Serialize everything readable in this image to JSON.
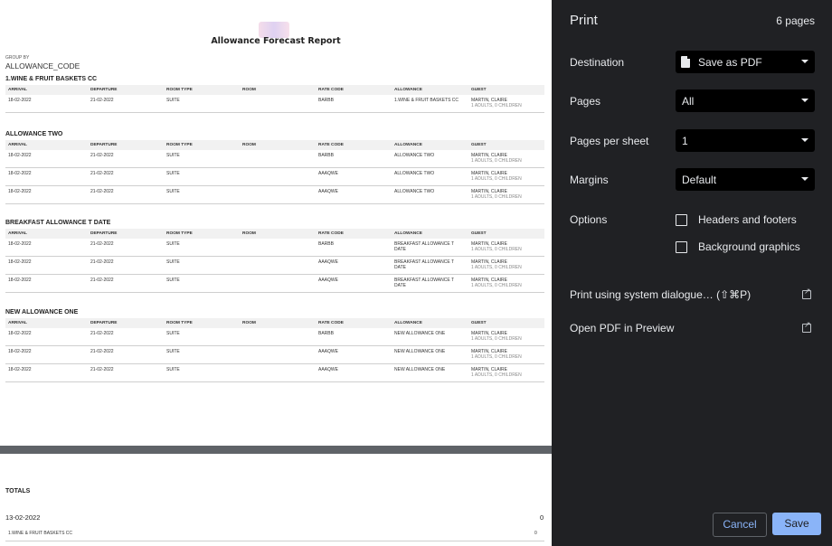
{
  "report": {
    "title": "Allowance Forecast Report",
    "group_by_label": "GROUP BY",
    "group_by_value": "ALLOWANCE_CODE",
    "columns": [
      "ARRIVAL",
      "DEPARTURE",
      "ROOM TYPE",
      "ROOM",
      "RATE CODE",
      "ALLOWANCE",
      "GUEST"
    ],
    "sections": [
      {
        "title": "1.WINE & FRUIT BASKETS CC",
        "rows": [
          {
            "arrival": "18-02-2022",
            "departure": "21-02-2022",
            "room_type": "SUITE",
            "room": "",
            "rate_code": "BARBB",
            "allowance": "1.WINE & FRUIT BASKETS CC",
            "guest": "MARTIN, CLAIRE",
            "guest_sub": "1 ADULTS, 0 CHILDREN"
          }
        ]
      },
      {
        "title": "ALLOWANCE TWO",
        "rows": [
          {
            "arrival": "18-02-2022",
            "departure": "21-02-2022",
            "room_type": "SUITE",
            "room": "",
            "rate_code": "BARBB",
            "allowance": "ALLOWANCE TWO",
            "guest": "MARTIN, CLAIRE",
            "guest_sub": "1 ADULTS, 0 CHILDREN"
          },
          {
            "arrival": "18-02-2022",
            "departure": "21-02-2022",
            "room_type": "SUITE",
            "room": "",
            "rate_code": "AAAQWE",
            "allowance": "ALLOWANCE TWO",
            "guest": "MARTIN, CLAIRE",
            "guest_sub": "1 ADULTS, 0 CHILDREN"
          },
          {
            "arrival": "18-02-2022",
            "departure": "21-02-2022",
            "room_type": "SUITE",
            "room": "",
            "rate_code": "AAAQWE",
            "allowance": "ALLOWANCE TWO",
            "guest": "MARTIN, CLAIRE",
            "guest_sub": "1 ADULTS, 0 CHILDREN"
          }
        ]
      },
      {
        "title": "BREAKFAST ALLOWANCE T DATE",
        "rows": [
          {
            "arrival": "18-02-2022",
            "departure": "21-02-2022",
            "room_type": "SUITE",
            "room": "",
            "rate_code": "BARBB",
            "allowance": "BREAKFAST ALLOWANCE T DATE",
            "guest": "MARTIN, CLAIRE",
            "guest_sub": "1 ADULTS, 0 CHILDREN"
          },
          {
            "arrival": "18-02-2022",
            "departure": "21-02-2022",
            "room_type": "SUITE",
            "room": "",
            "rate_code": "AAAQWE",
            "allowance": "BREAKFAST ALLOWANCE T DATE",
            "guest": "MARTIN, CLAIRE",
            "guest_sub": "1 ADULTS, 0 CHILDREN"
          },
          {
            "arrival": "18-02-2022",
            "departure": "21-02-2022",
            "room_type": "SUITE",
            "room": "",
            "rate_code": "AAAQWE",
            "allowance": "BREAKFAST ALLOWANCE T DATE",
            "guest": "MARTIN, CLAIRE",
            "guest_sub": "1 ADULTS, 0 CHILDREN"
          }
        ]
      },
      {
        "title": "NEW ALLOWANCE ONE",
        "rows": [
          {
            "arrival": "18-02-2022",
            "departure": "21-02-2022",
            "room_type": "SUITE",
            "room": "",
            "rate_code": "BARBB",
            "allowance": "NEW ALLOWANCE ONE",
            "guest": "MARTIN, CLAIRE",
            "guest_sub": "1 ADULTS, 0 CHILDREN"
          },
          {
            "arrival": "18-02-2022",
            "departure": "21-02-2022",
            "room_type": "SUITE",
            "room": "",
            "rate_code": "AAAQWE",
            "allowance": "NEW ALLOWANCE ONE",
            "guest": "MARTIN, CLAIRE",
            "guest_sub": "1 ADULTS, 0 CHILDREN"
          },
          {
            "arrival": "18-02-2022",
            "departure": "21-02-2022",
            "room_type": "SUITE",
            "room": "",
            "rate_code": "AAAQWE",
            "allowance": "NEW ALLOWANCE ONE",
            "guest": "MARTIN, CLAIRE",
            "guest_sub": "1 ADULTS, 0 CHILDREN"
          }
        ]
      }
    ],
    "totals": {
      "label": "TOTALS",
      "date": "13-02-2022",
      "date_value": "0",
      "sub_label": "1.WINE & FRUIT BASKETS CC",
      "sub_value": "0"
    }
  },
  "print_dialog": {
    "title": "Print",
    "page_count": "6 pages",
    "destination_label": "Destination",
    "destination_value": "Save as PDF",
    "pages_label": "Pages",
    "pages_value": "All",
    "pages_per_sheet_label": "Pages per sheet",
    "pages_per_sheet_value": "1",
    "margins_label": "Margins",
    "margins_value": "Default",
    "options_label": "Options",
    "headers_footers": "Headers and footers",
    "background_graphics": "Background graphics",
    "system_dialog": "Print using system dialogue… (⇧⌘P)",
    "open_preview": "Open PDF in Preview",
    "cancel": "Cancel",
    "save": "Save",
    "accent_color": "#8ab4f8"
  }
}
